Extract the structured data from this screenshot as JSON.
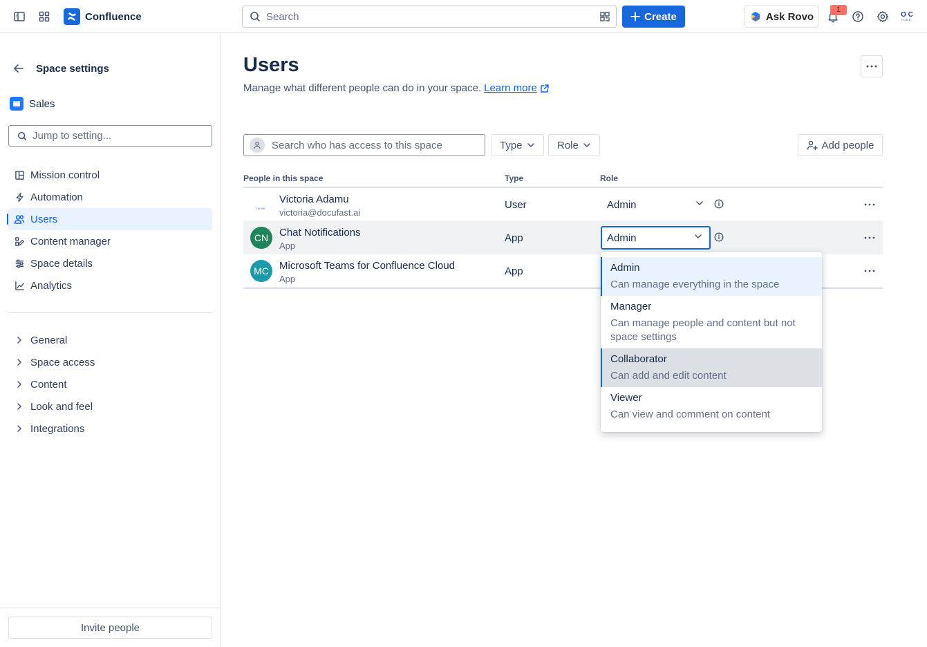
{
  "app": {
    "name": "Confluence"
  },
  "topbar": {
    "search_placeholder": "Search",
    "create_label": "Create",
    "rovo_label": "Ask Rovo",
    "notification_count": "1",
    "profile_initials_top": "O C",
    "profile_initials_bottom": "TURE."
  },
  "sidebar": {
    "title": "Space settings",
    "space_name": "Sales",
    "jump_placeholder": "Jump to setting...",
    "items": [
      {
        "label": "Mission control",
        "icon": "layout-icon"
      },
      {
        "label": "Automation",
        "icon": "lightning-icon"
      },
      {
        "label": "Users",
        "icon": "people-icon",
        "active": true
      },
      {
        "label": "Content manager",
        "icon": "edit-icon"
      },
      {
        "label": "Space details",
        "icon": "sliders-icon"
      },
      {
        "label": "Analytics",
        "icon": "chart-icon"
      }
    ],
    "groups": [
      "General",
      "Space access",
      "Content",
      "Look and feel",
      "Integrations"
    ],
    "invite_label": "Invite people"
  },
  "main": {
    "title": "Users",
    "description": "Manage what different people can do in your space.",
    "learn_more": "Learn more",
    "search_placeholder": "Search who has access to this space",
    "type_filter": "Type",
    "role_filter": "Role",
    "add_people": "Add people",
    "columns": [
      "People in this space",
      "Type",
      "Role"
    ],
    "rows": [
      {
        "name": "Victoria Adamu",
        "sub": "victoria@docufast.ai",
        "type": "User",
        "role": "Admin",
        "avatar": "O C"
      },
      {
        "name": "Chat Notifications",
        "sub": "App",
        "type": "App",
        "role": "Admin",
        "avatar": "CN",
        "avatar_color": "#1f845a"
      },
      {
        "name": "Microsoft Teams for Confluence Cloud",
        "sub": "App",
        "type": "App",
        "role": "",
        "avatar": "MC",
        "avatar_color": "#1d9aaa"
      }
    ]
  },
  "role_dropdown": {
    "options": [
      {
        "title": "Admin",
        "desc": "Can manage everything in the space",
        "state": "selected"
      },
      {
        "title": "Manager",
        "desc_line1": "Can manage people and content but not",
        "desc_line2": "space settings"
      },
      {
        "title": "Collaborator",
        "desc": "Can add and edit content",
        "state": "hover"
      },
      {
        "title": "Viewer",
        "desc": "Can view and comment on content"
      }
    ]
  },
  "colors": {
    "brand": "#1868db",
    "active_bg": "#e9f2ff"
  }
}
